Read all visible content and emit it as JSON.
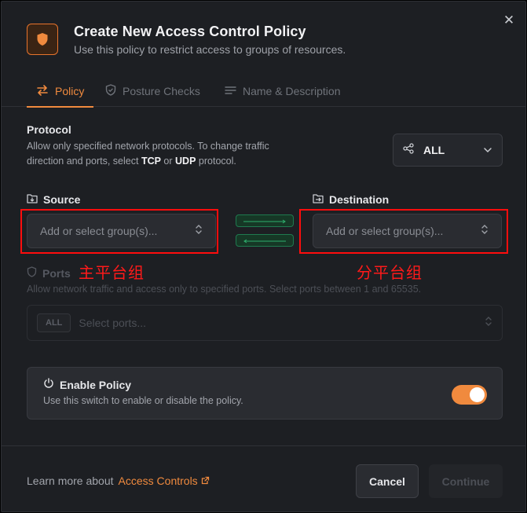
{
  "dialog": {
    "title": "Create New Access Control Policy",
    "subtitle": "Use this policy to restrict access to groups of resources.",
    "close_glyph": "✕"
  },
  "tabs": [
    {
      "label": "Policy",
      "icon": "arrows-swap-icon",
      "active": true
    },
    {
      "label": "Posture Checks",
      "icon": "shield-check-icon",
      "active": false
    },
    {
      "label": "Name & Description",
      "icon": "text-lines-icon",
      "active": false
    }
  ],
  "protocol": {
    "label": "Protocol",
    "help_line1": "Allow only specified network protocols. To change traffic",
    "help_line2_prefix": "direction and ports, select",
    "help_tcp": "TCP",
    "help_or": "or",
    "help_udp": "UDP",
    "help_suffix": "protocol.",
    "selected": "ALL",
    "icon": "share-nodes-icon"
  },
  "source": {
    "label": "Source",
    "placeholder": "Add or select group(s)...",
    "annotation": "主平台组"
  },
  "destination": {
    "label": "Destination",
    "placeholder": "Add or select group(s)...",
    "annotation": "分平台组"
  },
  "ports": {
    "label": "Ports",
    "help": "Allow network traffic and access only to specified ports. Select ports between 1 and 65535.",
    "chip": "ALL",
    "placeholder": "Select ports..."
  },
  "enable_policy": {
    "label": "Enable Policy",
    "help": "Use this switch to enable or disable the policy.",
    "enabled": true
  },
  "footer": {
    "learn_prefix": "Learn more about",
    "learn_link": "Access Controls",
    "cancel": "Cancel",
    "continue": "Continue"
  },
  "colors": {
    "accent": "#f08a3e",
    "annotation_red": "#ff0d0d",
    "direction_green": "#1f7a4f"
  }
}
